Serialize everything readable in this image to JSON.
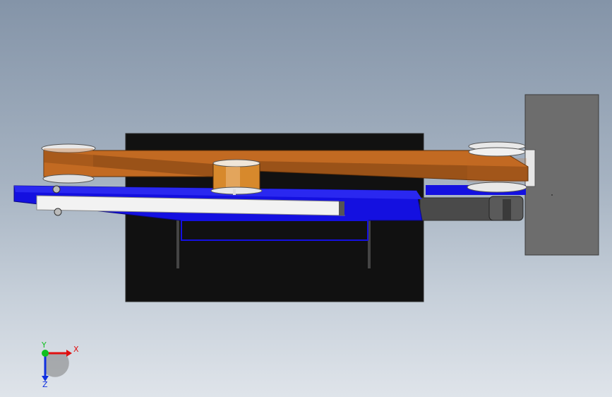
{
  "viewport": {
    "background_top": "#8494a8",
    "background_bottom": "#dfe4ea"
  },
  "model": {
    "parts": [
      {
        "name": "black-backplate",
        "color": "#111111"
      },
      {
        "name": "gray-mount-block",
        "color": "#6d6d6d"
      },
      {
        "name": "blue-base-plate",
        "color": "#1410e0"
      },
      {
        "name": "white-bar",
        "color": "#f2f2f2"
      },
      {
        "name": "orange-link",
        "color": "#c26a22"
      },
      {
        "name": "dark-gray-arm",
        "color": "#4a4a4a"
      }
    ]
  },
  "triad": {
    "x_label": "X",
    "y_label": "Y",
    "z_label": "Z",
    "x_color": "#e01010",
    "y_color": "#10c020",
    "z_color": "#1030e0"
  }
}
